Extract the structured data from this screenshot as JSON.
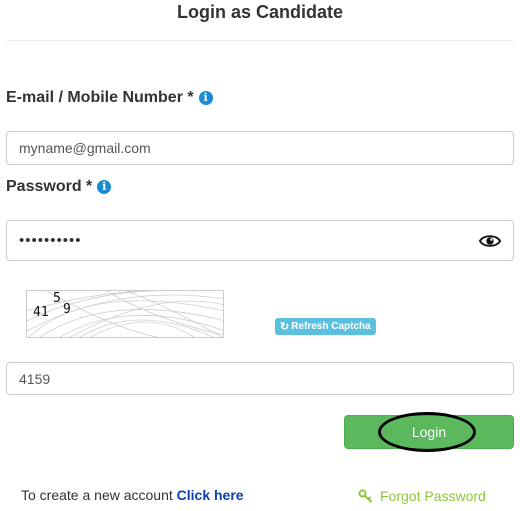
{
  "header": {
    "title": "Login as Candidate"
  },
  "email": {
    "label": "E-mail / Mobile Number *",
    "value": "myname@gmail.com"
  },
  "password": {
    "label": "Password *",
    "value": "••••••••••"
  },
  "captcha": {
    "digits": [
      "41",
      "5",
      "9"
    ],
    "refresh_label": "Refresh Captcha",
    "answer": "4159"
  },
  "login": {
    "label": "Login"
  },
  "footer": {
    "create_text": "To create a new account",
    "click_here": "Click here",
    "forgot_label": "Forgot Password"
  },
  "colors": {
    "info": "#1a8ad4",
    "refresh": "#5bc0de",
    "login": "#5cb85c",
    "link": "#0b3fb0",
    "forgot": "#8dc63f"
  },
  "icons": [
    "info-icon",
    "eye-icon",
    "refresh-icon",
    "key-icon"
  ]
}
